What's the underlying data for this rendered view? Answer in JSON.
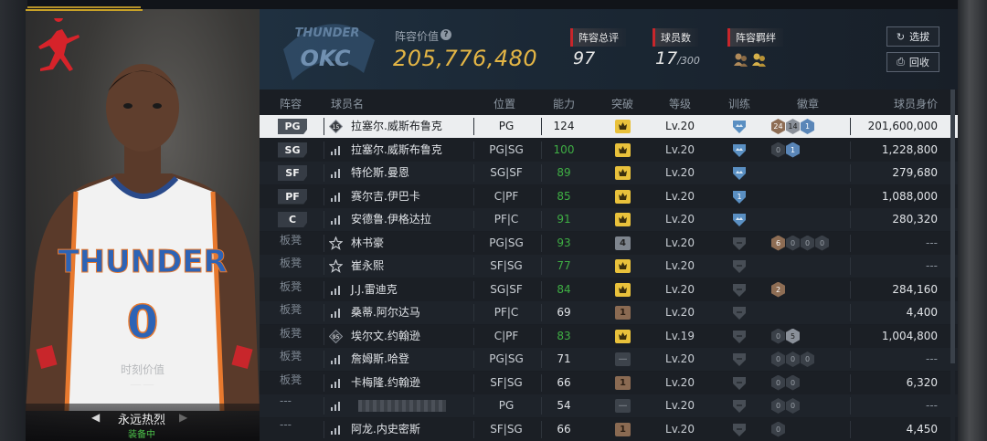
{
  "card": {
    "moment_label": "时刻价值",
    "moment_value": "——",
    "skin_name": "永远热烈",
    "equipped": "装备中",
    "prev_icon": "triangle-left-icon",
    "next_icon": "triangle-right-icon"
  },
  "header": {
    "lineup_value_label": "阵容价值",
    "lineup_value": "205,776,480",
    "rating_label": "阵容总评",
    "rating_value": "97",
    "players_label": "球员数",
    "players_value": "17",
    "players_max": "/300",
    "chem_label": "阵容羁绊",
    "btn_select": "选拔",
    "btn_recycle": "回收",
    "colors": {
      "accent_gold": "#e3b545",
      "tag_red": "#c8262b"
    }
  },
  "table": {
    "headers": {
      "lineup": "阵容",
      "name": "球员名",
      "position": "位置",
      "ability": "能力",
      "breakthrough": "突破",
      "level": "等级",
      "training": "训练",
      "badges": "徽章",
      "value": "球员身价"
    },
    "rows": [
      {
        "slot": "PG",
        "bench": false,
        "icon": "rank-15",
        "name": "拉塞尔.威斯布鲁克",
        "pos": "PG",
        "abl": "124",
        "abl_green": false,
        "brk": "gold",
        "lvl": "Lv.20",
        "train": "blue",
        "medals": [
          [
            "bronze",
            "24"
          ],
          [
            "silver",
            "14"
          ],
          [
            "blue",
            "1"
          ]
        ],
        "value": "201,600,000",
        "selected": true
      },
      {
        "slot": "SG",
        "bench": false,
        "icon": "bars",
        "name": "拉塞尔.威斯布鲁克",
        "pos": "PG|SG",
        "abl": "100",
        "abl_green": true,
        "brk": "gold",
        "lvl": "Lv.20",
        "train": "blue",
        "medals": [
          [
            "dark",
            "0"
          ],
          [
            "blue",
            "1"
          ]
        ],
        "value": "1,228,800"
      },
      {
        "slot": "SF",
        "bench": false,
        "icon": "bars",
        "name": "特伦斯.曼恩",
        "pos": "SG|SF",
        "abl": "89",
        "abl_green": true,
        "brk": "gold",
        "lvl": "Lv.20",
        "train": "blue",
        "medals": [],
        "value": "279,680"
      },
      {
        "slot": "PF",
        "bench": false,
        "icon": "bars",
        "name": "赛尔吉.伊巴卡",
        "pos": "C|PF",
        "abl": "85",
        "abl_green": true,
        "brk": "gold",
        "lvl": "Lv.20",
        "train": "blue1",
        "medals": [],
        "value": "1,088,000"
      },
      {
        "slot": "C",
        "bench": false,
        "icon": "bars",
        "name": "安德鲁.伊格达拉",
        "pos": "PF|C",
        "abl": "91",
        "abl_green": true,
        "brk": "gold",
        "lvl": "Lv.20",
        "train": "blue",
        "medals": [],
        "value": "280,320"
      },
      {
        "slot": "板凳",
        "bench": true,
        "icon": "star",
        "name": "林书豪",
        "pos": "PG|SG",
        "abl": "93",
        "abl_green": true,
        "brk": "silver4",
        "lvl": "Lv.20",
        "train": "grey",
        "medals": [
          [
            "bronze",
            "6"
          ],
          [
            "dark",
            "0"
          ],
          [
            "dark",
            "0"
          ],
          [
            "dark",
            "0"
          ]
        ],
        "value": "---"
      },
      {
        "slot": "板凳",
        "bench": true,
        "icon": "star",
        "name": "崔永熙",
        "pos": "SF|SG",
        "abl": "77",
        "abl_green": true,
        "brk": "gold",
        "lvl": "Lv.20",
        "train": "grey",
        "medals": [],
        "value": "---"
      },
      {
        "slot": "板凳",
        "bench": true,
        "icon": "bars",
        "name": "J.J.雷迪克",
        "pos": "SG|SF",
        "abl": "84",
        "abl_green": true,
        "brk": "gold",
        "lvl": "Lv.20",
        "train": "grey",
        "medals": [
          [
            "bronze",
            "2"
          ]
        ],
        "value": "284,160"
      },
      {
        "slot": "板凳",
        "bench": true,
        "icon": "bars",
        "name": "桑蒂.阿尔达马",
        "pos": "PF|C",
        "abl": "69",
        "abl_green": false,
        "brk": "bronze1",
        "lvl": "Lv.20",
        "train": "grey",
        "medals": [],
        "value": "4,400"
      },
      {
        "slot": "板凳",
        "bench": true,
        "icon": "rank-95",
        "name": "埃尔文.约翰逊",
        "pos": "C|PF",
        "abl": "83",
        "abl_green": true,
        "brk": "gold",
        "lvl": "Lv.19",
        "train": "grey",
        "medals": [
          [
            "dark",
            "0"
          ],
          [
            "silver",
            "5"
          ]
        ],
        "value": "1,004,800"
      },
      {
        "slot": "板凳",
        "bench": true,
        "icon": "bars",
        "name": "詹姆斯.哈登",
        "pos": "PG|SG",
        "abl": "71",
        "abl_green": false,
        "brk": "none",
        "lvl": "Lv.20",
        "train": "grey",
        "medals": [
          [
            "dark",
            "0"
          ],
          [
            "dark",
            "0"
          ],
          [
            "dark",
            "0"
          ]
        ],
        "value": "---"
      },
      {
        "slot": "板凳",
        "bench": true,
        "icon": "bars",
        "name": "卡梅隆.约翰逊",
        "pos": "SF|SG",
        "abl": "66",
        "abl_green": false,
        "brk": "bronze1",
        "lvl": "Lv.20",
        "train": "grey",
        "medals": [
          [
            "dark",
            "0"
          ],
          [
            "dark",
            "0"
          ]
        ],
        "value": "6,320"
      },
      {
        "slot": "---",
        "bench": true,
        "icon": "bars",
        "name": "",
        "pos": "PG",
        "abl": "54",
        "abl_green": false,
        "brk": "none",
        "lvl": "Lv.20",
        "train": "grey",
        "medals": [
          [
            "dark",
            "0"
          ],
          [
            "dark",
            "0"
          ]
        ],
        "value": "---"
      },
      {
        "slot": "---",
        "bench": true,
        "icon": "bars",
        "name": "阿龙.内史密斯",
        "pos": "SF|SG",
        "abl": "66",
        "abl_green": false,
        "brk": "bronze1",
        "lvl": "Lv.20",
        "train": "grey",
        "medals": [
          [
            "dark",
            "0"
          ]
        ],
        "value": "4,450"
      }
    ]
  }
}
